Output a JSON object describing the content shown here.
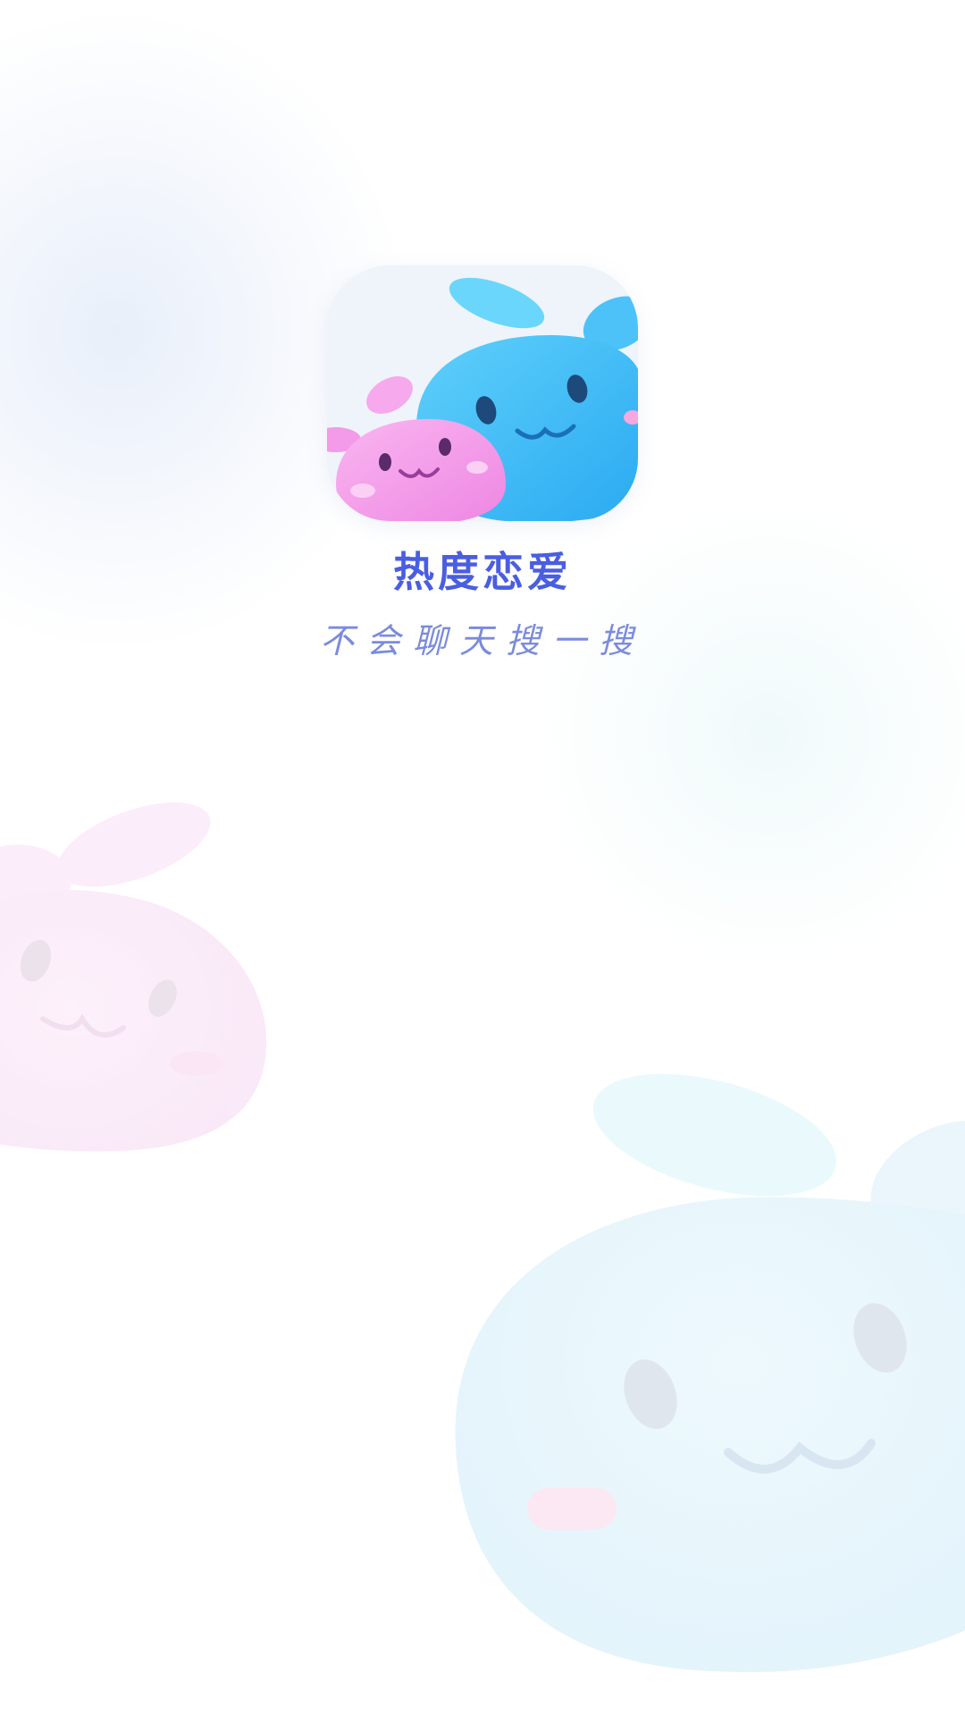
{
  "app": {
    "name": "热度恋爱",
    "slogan": "不会聊天搜一搜"
  },
  "icons": {
    "app_icon": "two-bunny-slimes-logo",
    "bg_pink": "pink-bunny-slime",
    "bg_blue": "blue-bunny-slime"
  },
  "colors": {
    "title": "#4a5ee0",
    "slogan": "#7b8bdc",
    "blue_slime": "#3fb9f5",
    "pink_slime": "#f39ae8"
  }
}
